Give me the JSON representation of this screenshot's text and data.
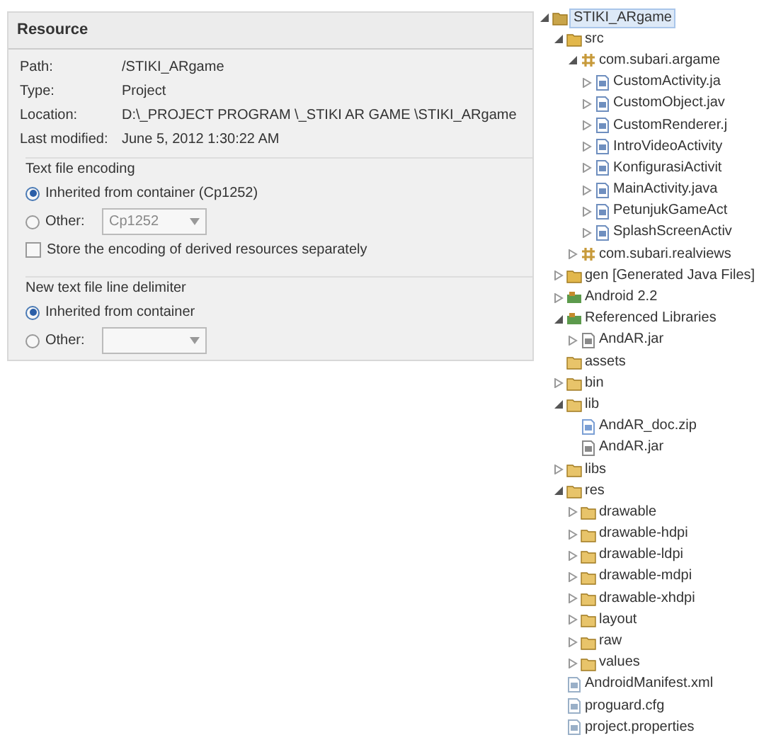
{
  "properties": {
    "title": "Resource",
    "fields": [
      {
        "label": "Path:",
        "value": "/STIKI_ARgame"
      },
      {
        "label": "Type:",
        "value": "Project"
      },
      {
        "label": "Location:",
        "value": "D:\\_PROJECT PROGRAM \\_STIKI AR GAME \\STIKI_ARgame"
      },
      {
        "label": "Last modified:",
        "value": "June 5, 2012 1:30:22 AM"
      }
    ],
    "groups": [
      {
        "title": "Text file encoding",
        "options": [
          {
            "label": "Inherited from container (Cp1252)",
            "selected": true
          },
          {
            "label": "Other:",
            "selected": false,
            "kind": "combo",
            "value": "Cp1252"
          }
        ],
        "checkbox": {
          "label": "Store the encoding of derived resources separately",
          "checked": false
        }
      },
      {
        "title": "New text file line delimiter",
        "options": [
          {
            "label": "Inherited from container",
            "selected": true
          },
          {
            "label": "Other:",
            "selected": false,
            "kind": "combo"
          }
        ]
      }
    ]
  },
  "tree": [
    {
      "label": "STIKI_ARgame",
      "kind": "project",
      "expanded": true,
      "selected": true,
      "children": [
        {
          "label": "src",
          "kind": "srcfolder",
          "expanded": true,
          "children": [
            {
              "label": "com.subari.argame",
              "kind": "package",
              "expanded": true,
              "children": [
                {
                  "label": "CustomActivity.ja",
                  "kind": "java",
                  "expanded": false
                },
                {
                  "label": "CustomObject.jav",
                  "kind": "java",
                  "expanded": false
                },
                {
                  "label": "CustomRenderer.j",
                  "kind": "java",
                  "expanded": false
                },
                {
                  "label": "IntroVideoActivity",
                  "kind": "java",
                  "expanded": false
                },
                {
                  "label": "KonfigurasiActivit",
                  "kind": "java",
                  "expanded": false
                },
                {
                  "label": "MainActivity.java",
                  "kind": "java",
                  "expanded": false
                },
                {
                  "label": "PetunjukGameAct",
                  "kind": "java",
                  "expanded": false
                },
                {
                  "label": "SplashScreenActiv",
                  "kind": "java",
                  "expanded": false
                }
              ]
            },
            {
              "label": "com.subari.realviews",
              "kind": "package",
              "expanded": false
            }
          ]
        },
        {
          "label": "gen [Generated Java Files]",
          "kind": "srcfolder",
          "expanded": false
        },
        {
          "label": "Android 2.2",
          "kind": "library",
          "expanded": false
        },
        {
          "label": "Referenced Libraries",
          "kind": "library",
          "expanded": true,
          "children": [
            {
              "label": "AndAR.jar",
              "kind": "jar",
              "expanded": false
            }
          ]
        },
        {
          "label": "assets",
          "kind": "folder"
        },
        {
          "label": "bin",
          "kind": "folder",
          "expanded": false
        },
        {
          "label": "lib",
          "kind": "folder",
          "expanded": true,
          "children": [
            {
              "label": "AndAR_doc.zip",
              "kind": "zip"
            },
            {
              "label": "AndAR.jar",
              "kind": "jar"
            }
          ]
        },
        {
          "label": "libs",
          "kind": "folder",
          "expanded": false
        },
        {
          "label": "res",
          "kind": "folder",
          "expanded": true,
          "children": [
            {
              "label": "drawable",
              "kind": "folder",
              "expanded": false
            },
            {
              "label": "drawable-hdpi",
              "kind": "folder",
              "expanded": false
            },
            {
              "label": "drawable-ldpi",
              "kind": "folder",
              "expanded": false
            },
            {
              "label": "drawable-mdpi",
              "kind": "folder",
              "expanded": false
            },
            {
              "label": "drawable-xhdpi",
              "kind": "folder",
              "expanded": false
            },
            {
              "label": "layout",
              "kind": "folder",
              "expanded": false
            },
            {
              "label": "raw",
              "kind": "folder",
              "expanded": false
            },
            {
              "label": "values",
              "kind": "folder",
              "expanded": false
            }
          ]
        },
        {
          "label": "AndroidManifest.xml",
          "kind": "file"
        },
        {
          "label": "proguard.cfg",
          "kind": "file"
        },
        {
          "label": "project.properties",
          "kind": "file"
        }
      ]
    }
  ]
}
